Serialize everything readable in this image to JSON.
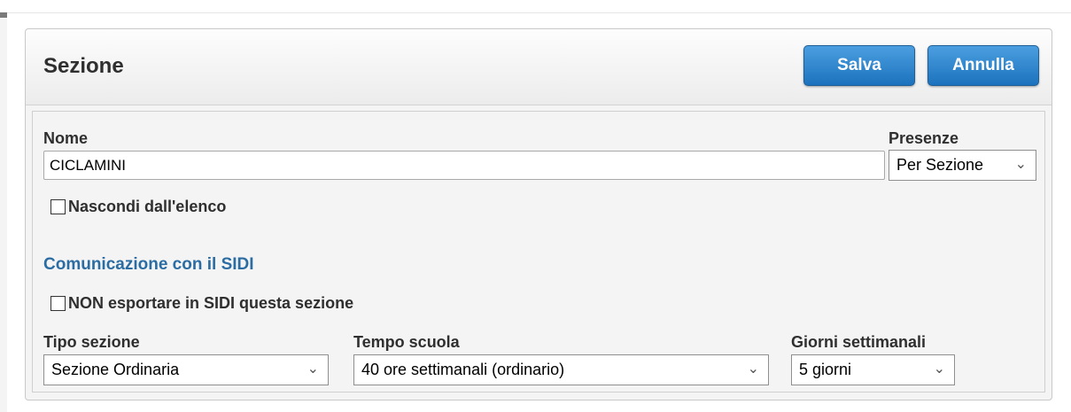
{
  "header": {
    "title": "Sezione",
    "save_label": "Salva",
    "cancel_label": "Annulla"
  },
  "form": {
    "nome_label": "Nome",
    "nome_value": "CICLAMINI",
    "presenze_label": "Presenze",
    "presenze_value": "Per Sezione",
    "hide_checkbox": {
      "label": "Nascondi dall'elenco",
      "checked": false
    },
    "sidi_section_title": "Comunicazione con il SIDI",
    "no_export_checkbox": {
      "label": "NON esportare in SIDI questa sezione",
      "checked": false
    },
    "tipo_sezione_label": "Tipo sezione",
    "tipo_sezione_value": "Sezione Ordinaria",
    "tempo_scuola_label": "Tempo scuola",
    "tempo_scuola_value": "40 ore settimanali (ordinario)",
    "giorni_label": "Giorni settimanali",
    "giorni_value": "5 giorni"
  },
  "icons": {
    "dropdown": "chevron-down-icon",
    "checkbox": "checkbox-icon"
  },
  "colors": {
    "button_blue": "#1c72bd",
    "section_title_blue": "#2b6ca3",
    "panel_background": "#f4f4f4"
  }
}
